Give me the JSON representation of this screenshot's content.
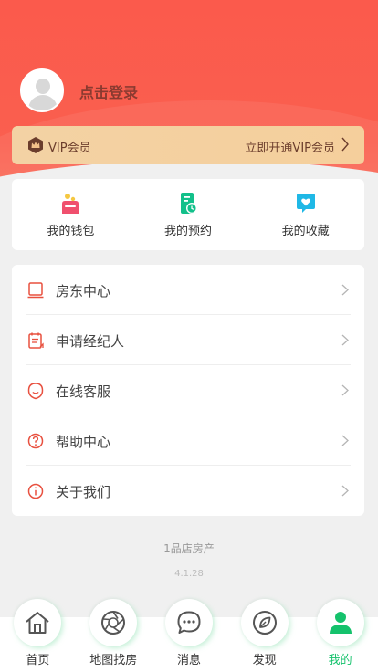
{
  "profile": {
    "login_label": "点击登录"
  },
  "vip": {
    "title": "VIP会员",
    "action": "立即开通VIP会员",
    "accent": "#6b3d2c"
  },
  "quick_actions": [
    {
      "label": "我的钱包",
      "icon": "wallet-icon"
    },
    {
      "label": "我的预约",
      "icon": "appointment-icon"
    },
    {
      "label": "我的收藏",
      "icon": "favorites-icon"
    }
  ],
  "menu": [
    {
      "label": "房东中心",
      "icon": "landlord-icon"
    },
    {
      "label": "申请经纪人",
      "icon": "apply-agent-icon"
    },
    {
      "label": "在线客服",
      "icon": "customer-service-icon"
    },
    {
      "label": "帮助中心",
      "icon": "help-icon"
    },
    {
      "label": "关于我们",
      "icon": "info-icon"
    }
  ],
  "footer": {
    "brand": "1品店房产",
    "version": "4.1.28"
  },
  "tabbar": [
    {
      "label": "首页",
      "icon": "home-icon"
    },
    {
      "label": "地图找房",
      "icon": "map-aperture-icon"
    },
    {
      "label": "消息",
      "icon": "message-icon"
    },
    {
      "label": "发现",
      "icon": "discover-icon"
    },
    {
      "label": "我的",
      "icon": "profile-icon",
      "active": true
    }
  ],
  "colors": {
    "hero": "#fb5a4c",
    "menu_icon": "#e8503f",
    "active_tab": "#15c26c"
  }
}
